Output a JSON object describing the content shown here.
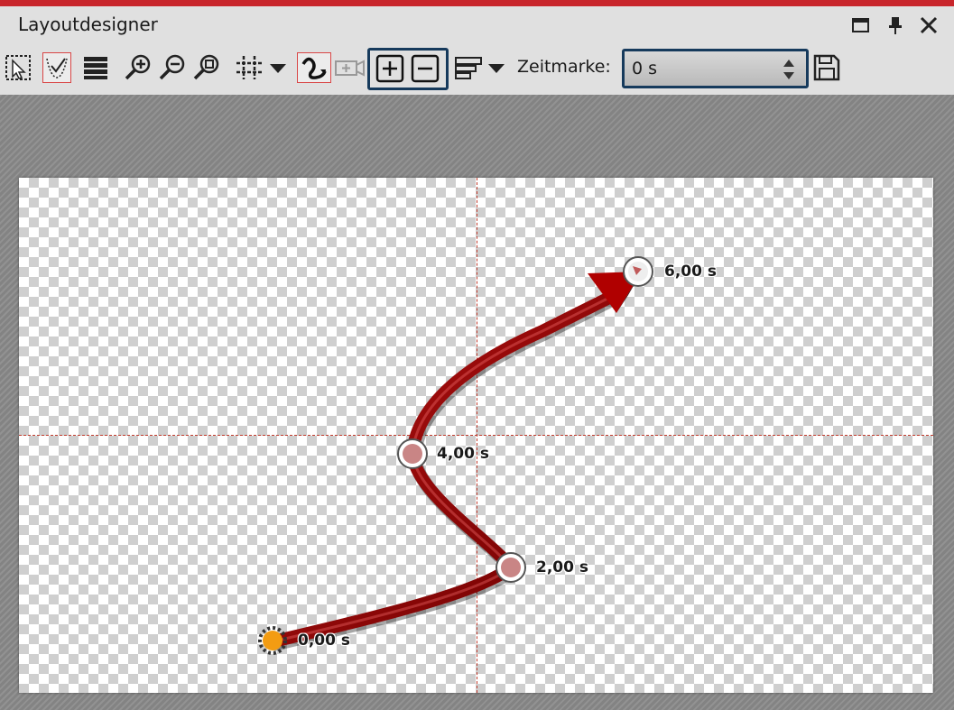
{
  "window": {
    "title": "Layoutdesigner",
    "accent_color": "#c8252b",
    "controls": [
      "maximize-icon",
      "pin-icon",
      "close-icon"
    ]
  },
  "toolbar": {
    "tools": [
      {
        "name": "select-tool-icon",
        "active": false
      },
      {
        "name": "motion-path-tool-icon",
        "active": true
      },
      {
        "name": "layers-list-icon",
        "active": false
      },
      {
        "name": "zoom-in-icon",
        "active": false
      },
      {
        "name": "zoom-out-icon",
        "active": false
      },
      {
        "name": "zoom-fit-icon",
        "active": false
      },
      {
        "name": "grid-icon",
        "active": false
      },
      {
        "name": "curve-path-icon",
        "active": true
      },
      {
        "name": "camera-icon",
        "active": false
      },
      {
        "name": "add-keyframe-icon",
        "active": false
      },
      {
        "name": "remove-keyframe-icon",
        "active": false
      },
      {
        "name": "align-icon",
        "active": false
      },
      {
        "name": "save-icon",
        "active": false
      }
    ],
    "zeitmarke_label": "Zeitmarke:",
    "zeitmarke_value": "0 s",
    "highlight_color": "#163a5c"
  },
  "canvas": {
    "path_color": "#8b0000",
    "start_marker_color": "#f39c12",
    "keyframes": [
      {
        "label": "0,00 s"
      },
      {
        "label": "2,00 s"
      },
      {
        "label": "4,00 s"
      },
      {
        "label": "6,00 s"
      }
    ]
  }
}
